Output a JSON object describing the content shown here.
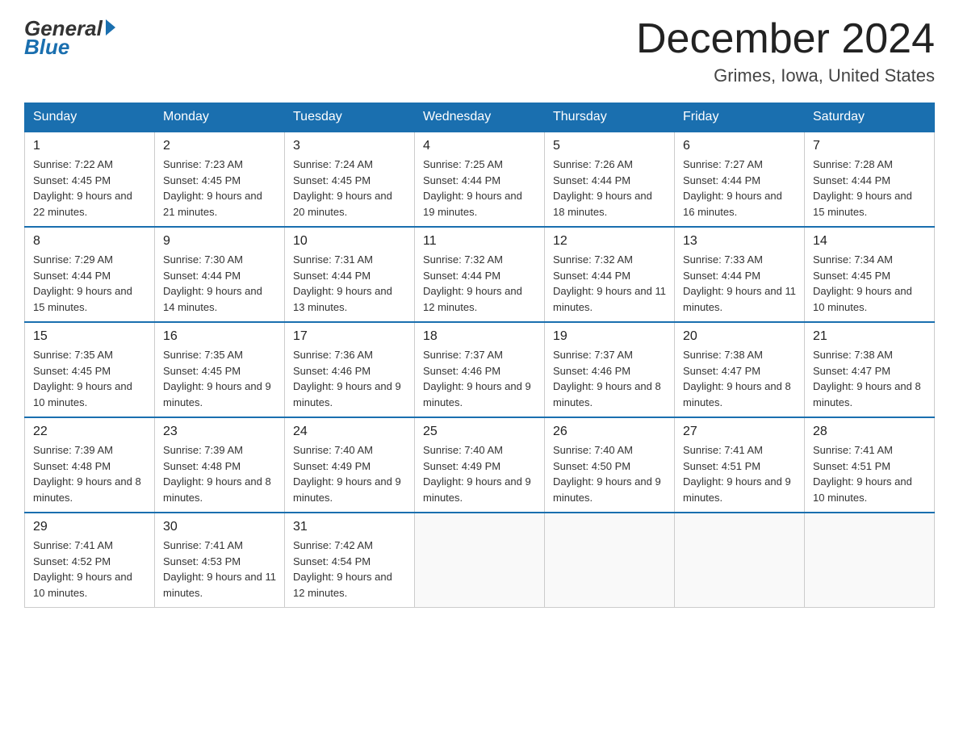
{
  "header": {
    "logo_general": "General",
    "logo_blue": "Blue",
    "month_title": "December 2024",
    "location": "Grimes, Iowa, United States"
  },
  "days_of_week": [
    "Sunday",
    "Monday",
    "Tuesday",
    "Wednesday",
    "Thursday",
    "Friday",
    "Saturday"
  ],
  "weeks": [
    [
      {
        "day": "1",
        "sunrise": "7:22 AM",
        "sunset": "4:45 PM",
        "daylight": "9 hours and 22 minutes."
      },
      {
        "day": "2",
        "sunrise": "7:23 AM",
        "sunset": "4:45 PM",
        "daylight": "9 hours and 21 minutes."
      },
      {
        "day": "3",
        "sunrise": "7:24 AM",
        "sunset": "4:45 PM",
        "daylight": "9 hours and 20 minutes."
      },
      {
        "day": "4",
        "sunrise": "7:25 AM",
        "sunset": "4:44 PM",
        "daylight": "9 hours and 19 minutes."
      },
      {
        "day": "5",
        "sunrise": "7:26 AM",
        "sunset": "4:44 PM",
        "daylight": "9 hours and 18 minutes."
      },
      {
        "day": "6",
        "sunrise": "7:27 AM",
        "sunset": "4:44 PM",
        "daylight": "9 hours and 16 minutes."
      },
      {
        "day": "7",
        "sunrise": "7:28 AM",
        "sunset": "4:44 PM",
        "daylight": "9 hours and 15 minutes."
      }
    ],
    [
      {
        "day": "8",
        "sunrise": "7:29 AM",
        "sunset": "4:44 PM",
        "daylight": "9 hours and 15 minutes."
      },
      {
        "day": "9",
        "sunrise": "7:30 AM",
        "sunset": "4:44 PM",
        "daylight": "9 hours and 14 minutes."
      },
      {
        "day": "10",
        "sunrise": "7:31 AM",
        "sunset": "4:44 PM",
        "daylight": "9 hours and 13 minutes."
      },
      {
        "day": "11",
        "sunrise": "7:32 AM",
        "sunset": "4:44 PM",
        "daylight": "9 hours and 12 minutes."
      },
      {
        "day": "12",
        "sunrise": "7:32 AM",
        "sunset": "4:44 PM",
        "daylight": "9 hours and 11 minutes."
      },
      {
        "day": "13",
        "sunrise": "7:33 AM",
        "sunset": "4:44 PM",
        "daylight": "9 hours and 11 minutes."
      },
      {
        "day": "14",
        "sunrise": "7:34 AM",
        "sunset": "4:45 PM",
        "daylight": "9 hours and 10 minutes."
      }
    ],
    [
      {
        "day": "15",
        "sunrise": "7:35 AM",
        "sunset": "4:45 PM",
        "daylight": "9 hours and 10 minutes."
      },
      {
        "day": "16",
        "sunrise": "7:35 AM",
        "sunset": "4:45 PM",
        "daylight": "9 hours and 9 minutes."
      },
      {
        "day": "17",
        "sunrise": "7:36 AM",
        "sunset": "4:46 PM",
        "daylight": "9 hours and 9 minutes."
      },
      {
        "day": "18",
        "sunrise": "7:37 AM",
        "sunset": "4:46 PM",
        "daylight": "9 hours and 9 minutes."
      },
      {
        "day": "19",
        "sunrise": "7:37 AM",
        "sunset": "4:46 PM",
        "daylight": "9 hours and 8 minutes."
      },
      {
        "day": "20",
        "sunrise": "7:38 AM",
        "sunset": "4:47 PM",
        "daylight": "9 hours and 8 minutes."
      },
      {
        "day": "21",
        "sunrise": "7:38 AM",
        "sunset": "4:47 PM",
        "daylight": "9 hours and 8 minutes."
      }
    ],
    [
      {
        "day": "22",
        "sunrise": "7:39 AM",
        "sunset": "4:48 PM",
        "daylight": "9 hours and 8 minutes."
      },
      {
        "day": "23",
        "sunrise": "7:39 AM",
        "sunset": "4:48 PM",
        "daylight": "9 hours and 8 minutes."
      },
      {
        "day": "24",
        "sunrise": "7:40 AM",
        "sunset": "4:49 PM",
        "daylight": "9 hours and 9 minutes."
      },
      {
        "day": "25",
        "sunrise": "7:40 AM",
        "sunset": "4:49 PM",
        "daylight": "9 hours and 9 minutes."
      },
      {
        "day": "26",
        "sunrise": "7:40 AM",
        "sunset": "4:50 PM",
        "daylight": "9 hours and 9 minutes."
      },
      {
        "day": "27",
        "sunrise": "7:41 AM",
        "sunset": "4:51 PM",
        "daylight": "9 hours and 9 minutes."
      },
      {
        "day": "28",
        "sunrise": "7:41 AM",
        "sunset": "4:51 PM",
        "daylight": "9 hours and 10 minutes."
      }
    ],
    [
      {
        "day": "29",
        "sunrise": "7:41 AM",
        "sunset": "4:52 PM",
        "daylight": "9 hours and 10 minutes."
      },
      {
        "day": "30",
        "sunrise": "7:41 AM",
        "sunset": "4:53 PM",
        "daylight": "9 hours and 11 minutes."
      },
      {
        "day": "31",
        "sunrise": "7:42 AM",
        "sunset": "4:54 PM",
        "daylight": "9 hours and 12 minutes."
      },
      null,
      null,
      null,
      null
    ]
  ]
}
